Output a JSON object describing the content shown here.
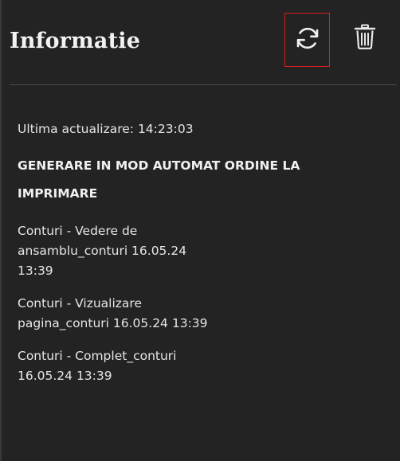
{
  "header": {
    "title": "Informatie",
    "refresh_icon": "refresh-icon",
    "trash_icon": "trash-icon"
  },
  "info": {
    "last_update": "Ultima actualizare: 14:23:03",
    "heading_line1": "GENERARE IN MOD AUTOMAT ORDINE LA",
    "heading_line2": "IMPRIMARE",
    "entries": [
      {
        "lines": [
          "Conturi - Vedere de",
          "ansamblu_conturi 16.05.24",
          "13:39"
        ]
      },
      {
        "lines": [
          "Conturi - Vizualizare",
          "pagina_conturi 16.05.24 13:39"
        ]
      },
      {
        "lines": [
          "Conturi - Complet_conturi",
          "16.05.24 13:39"
        ]
      }
    ]
  },
  "colors": {
    "background": "#232323",
    "text": "#e6e6e6",
    "highlight_border": "#e02020"
  }
}
